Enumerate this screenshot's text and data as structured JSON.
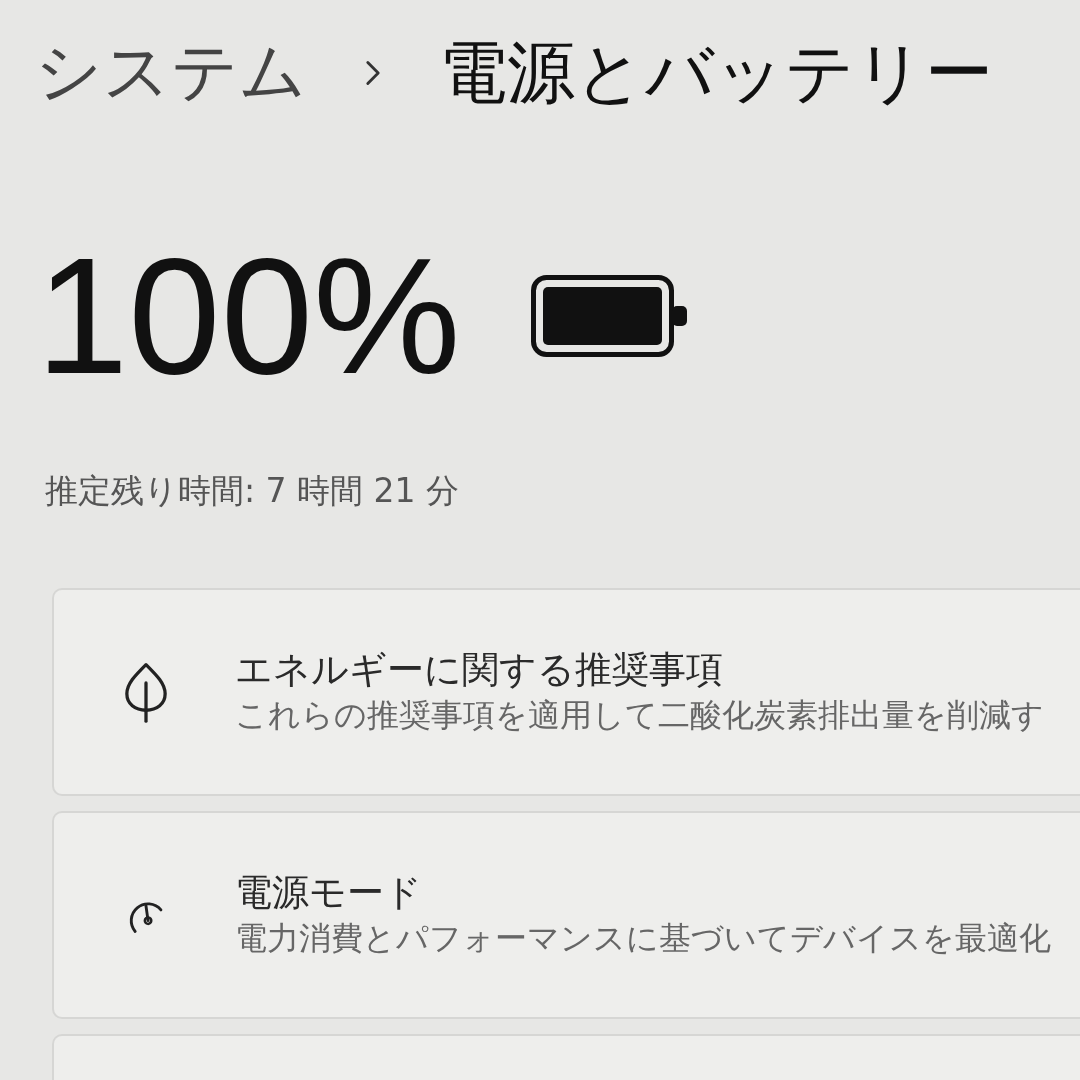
{
  "breadcrumb": {
    "parent": "システム",
    "current": "電源とバッテリー"
  },
  "battery": {
    "percent": "100%",
    "estimate": "推定残り時間: 7 時間 21 分"
  },
  "cards": [
    {
      "kind": "setting",
      "title": "エネルギーに関する推奨事項",
      "subtitle": "これらの推奨事項を適用して二酸化炭素排出量を削減す"
    },
    {
      "kind": "setting",
      "title": "電源モード",
      "subtitle": "電力消費とパフォーマンスに基づいてデバイスを最適化"
    },
    {
      "kind": "partial"
    }
  ]
}
